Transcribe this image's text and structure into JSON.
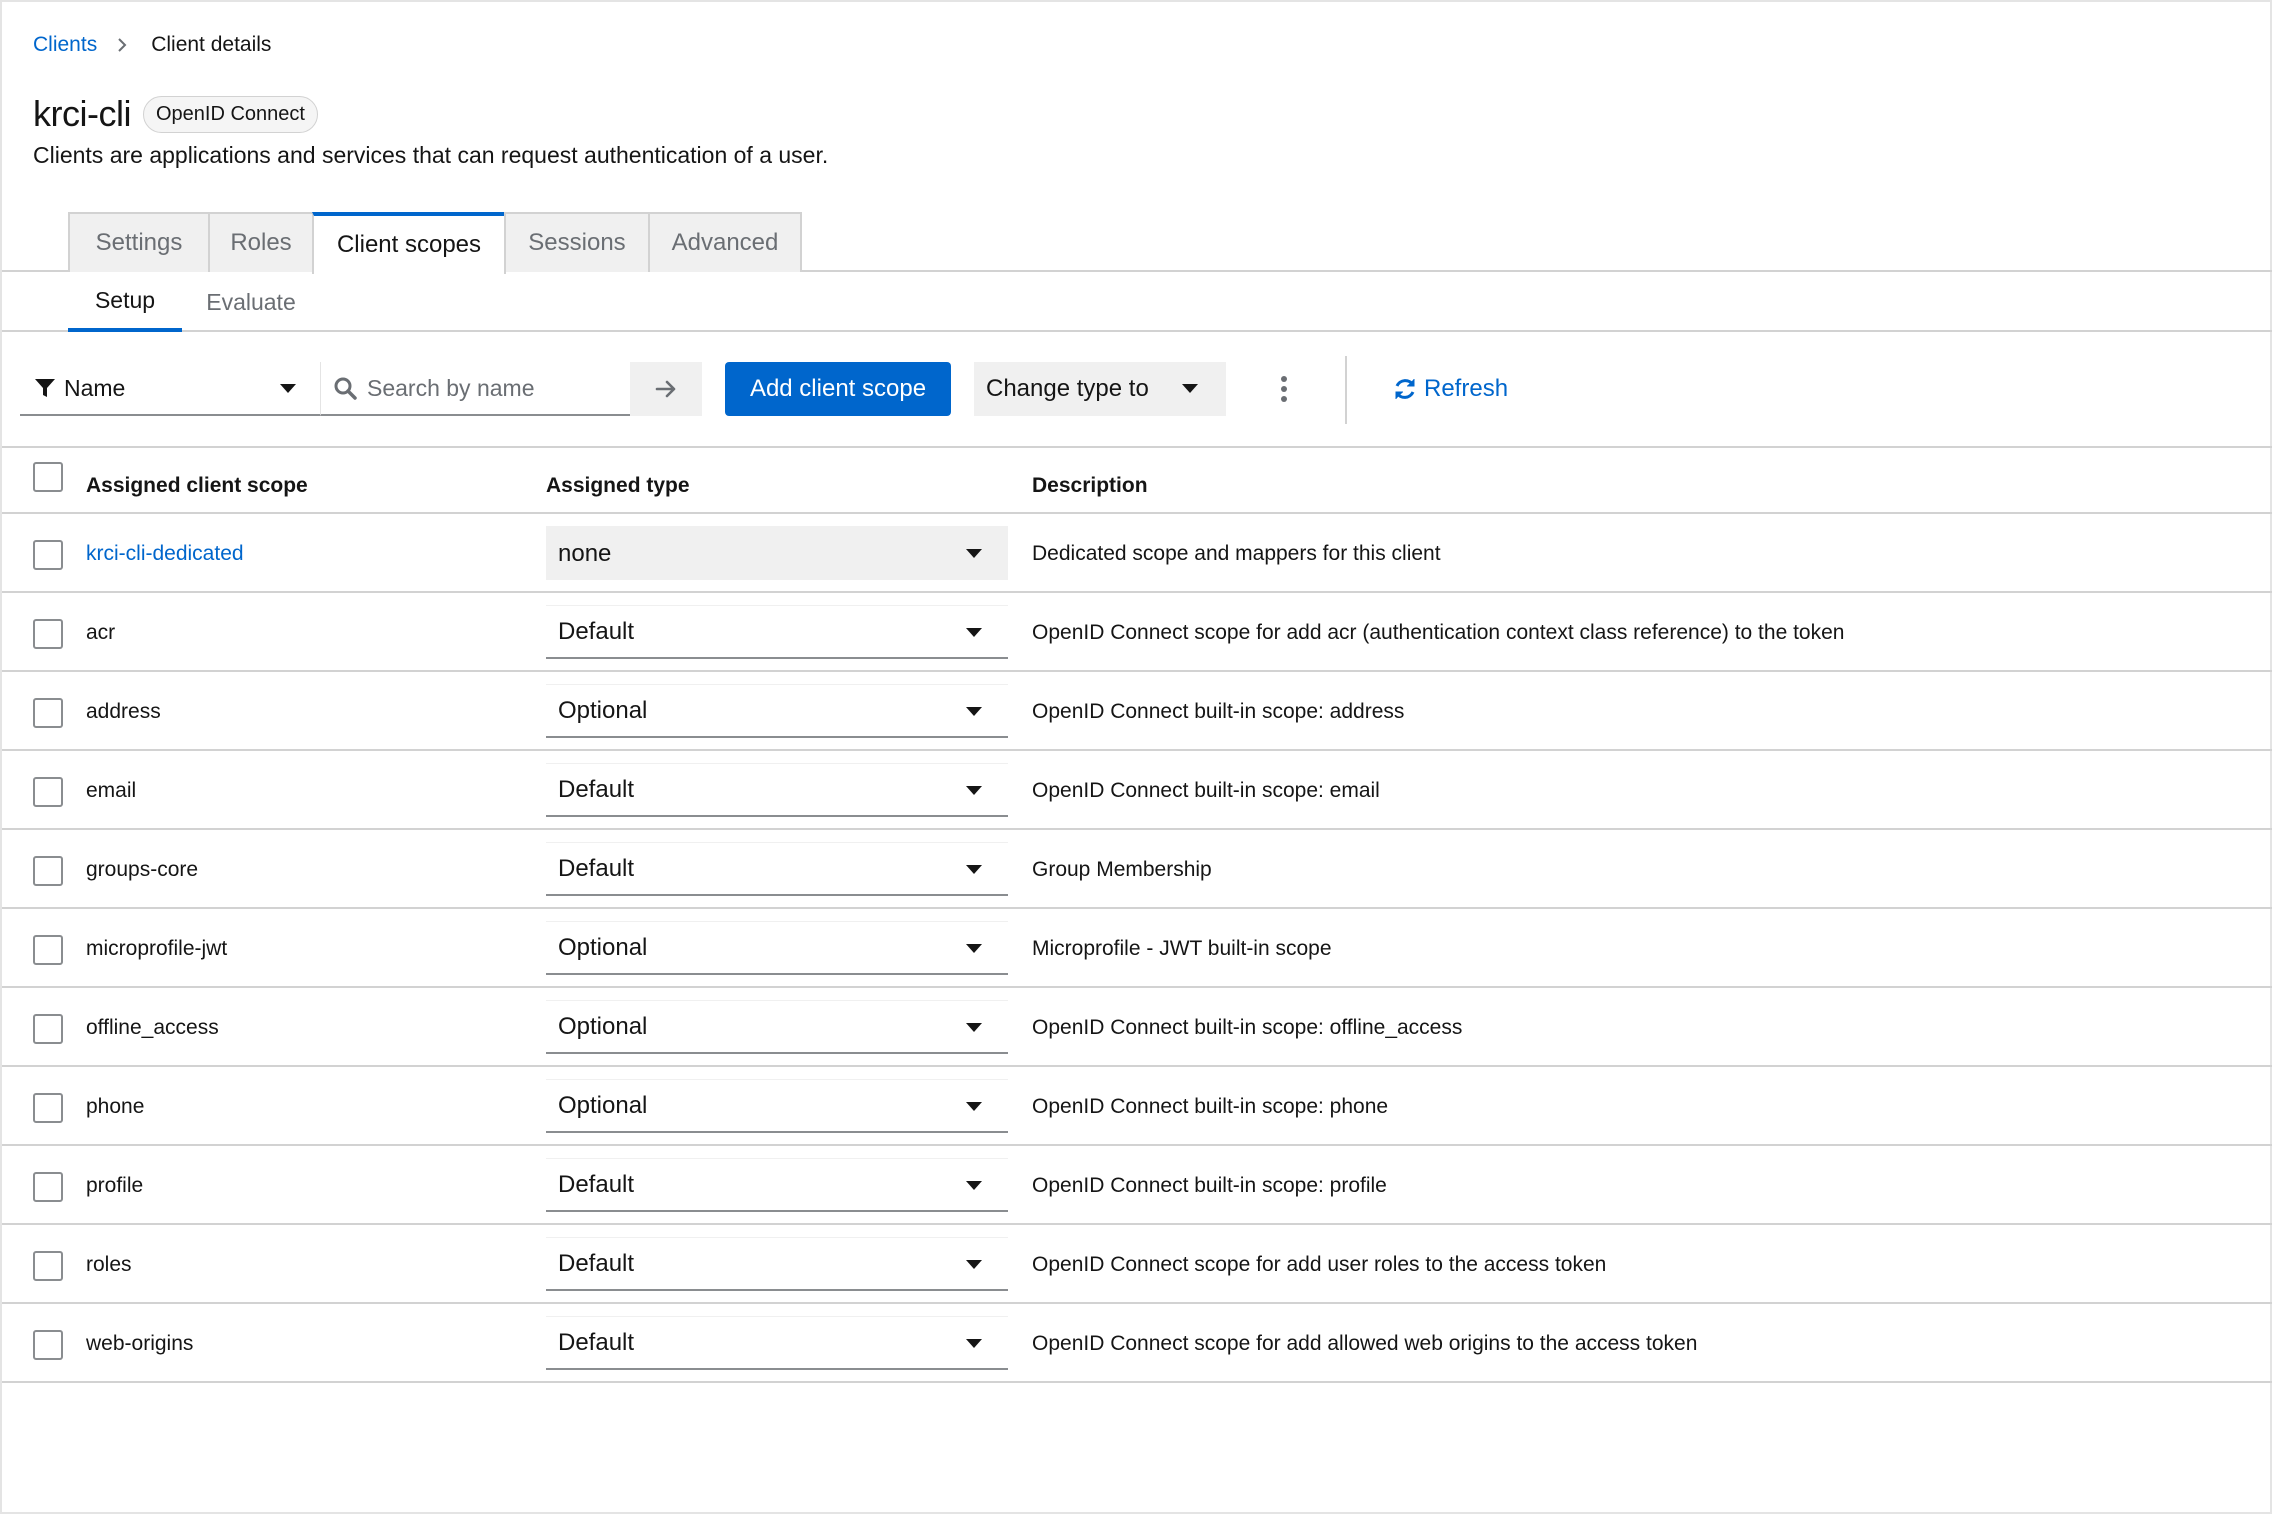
{
  "breadcrumb": {
    "parent": "Clients",
    "current": "Client details"
  },
  "header": {
    "title": "krci-cli",
    "badge": "OpenID Connect",
    "subtitle": "Clients are applications and services that can request authentication of a user."
  },
  "tabs": [
    "Settings",
    "Roles",
    "Client scopes",
    "Sessions",
    "Advanced"
  ],
  "active_tab": "Client scopes",
  "subtabs": [
    "Setup",
    "Evaluate"
  ],
  "active_subtab": "Setup",
  "toolbar": {
    "filter_label": "Name",
    "search_placeholder": "Search by name",
    "add_button": "Add client scope",
    "change_type_label": "Change type to",
    "refresh_label": "Refresh"
  },
  "table": {
    "columns": [
      "Assigned client scope",
      "Assigned type",
      "Description"
    ],
    "rows": [
      {
        "name": "krci-cli-dedicated",
        "type": "none",
        "description": "Dedicated scope and mappers for this client"
      },
      {
        "name": "acr",
        "type": "Default",
        "description": "OpenID Connect scope for add acr (authentication context class reference) to the token"
      },
      {
        "name": "address",
        "type": "Optional",
        "description": "OpenID Connect built-in scope: address"
      },
      {
        "name": "email",
        "type": "Default",
        "description": "OpenID Connect built-in scope: email"
      },
      {
        "name": "groups-core",
        "type": "Default",
        "description": "Group Membership"
      },
      {
        "name": "microprofile-jwt",
        "type": "Optional",
        "description": "Microprofile - JWT built-in scope"
      },
      {
        "name": "offline_access",
        "type": "Optional",
        "description": "OpenID Connect built-in scope: offline_access"
      },
      {
        "name": "phone",
        "type": "Optional",
        "description": "OpenID Connect built-in scope: phone"
      },
      {
        "name": "profile",
        "type": "Default",
        "description": "OpenID Connect built-in scope: profile"
      },
      {
        "name": "roles",
        "type": "Default",
        "description": "OpenID Connect scope for add user roles to the access token"
      },
      {
        "name": "web-origins",
        "type": "Default",
        "description": "OpenID Connect scope for add allowed web origins to the access token"
      }
    ]
  },
  "colors": {
    "accent": "#0066cc",
    "border": "#d2d2d2",
    "muted": "#6a6e73"
  }
}
